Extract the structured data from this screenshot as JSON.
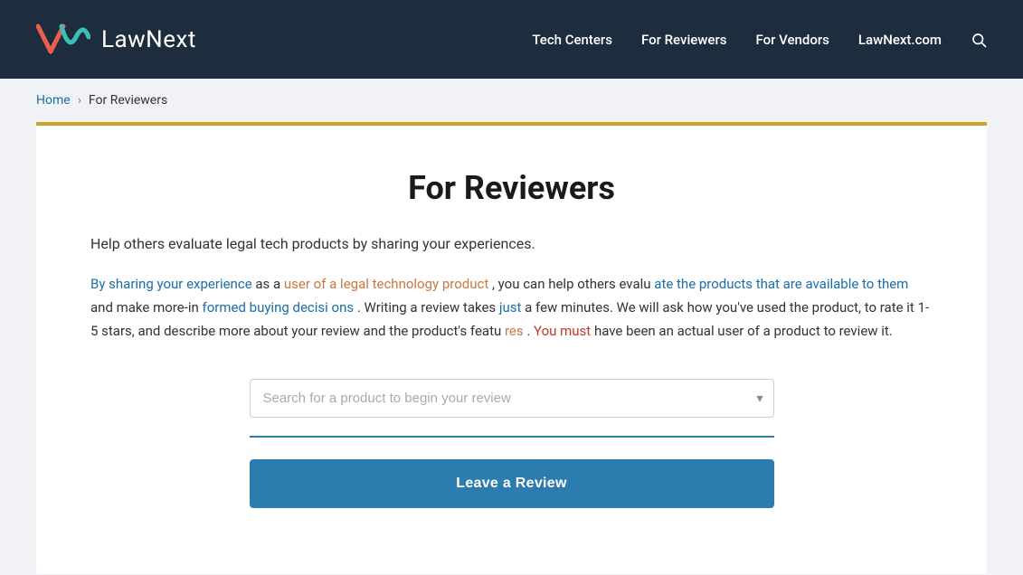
{
  "header": {
    "logo_text": "LawNext",
    "nav": {
      "items": [
        {
          "label": "Tech Centers",
          "id": "tech-centers"
        },
        {
          "label": "For Reviewers",
          "id": "for-reviewers"
        },
        {
          "label": "For Vendors",
          "id": "for-vendors"
        },
        {
          "label": "LawNext.com",
          "id": "lawnext-com"
        }
      ]
    }
  },
  "breadcrumb": {
    "home_label": "Home",
    "separator": "›",
    "current_label": "For Reviewers"
  },
  "main": {
    "page_title": "For Reviewers",
    "intro_text": "Help others evaluate legal tech products by sharing your experiences.",
    "body_text_segment1": "By sharing your experience as a user of a legal technology product, you can help others evaluate the products that are available to them and make more-informed buying decisions. Writing a review takes just a few minutes. We will ask how you've used the product, to rate it 1-5 stars, and describe more about your review and the product's features. You must have been an actual user of a product to review it.",
    "search_placeholder": "Search for a product to begin your review",
    "button_label": "Leave a Review"
  }
}
